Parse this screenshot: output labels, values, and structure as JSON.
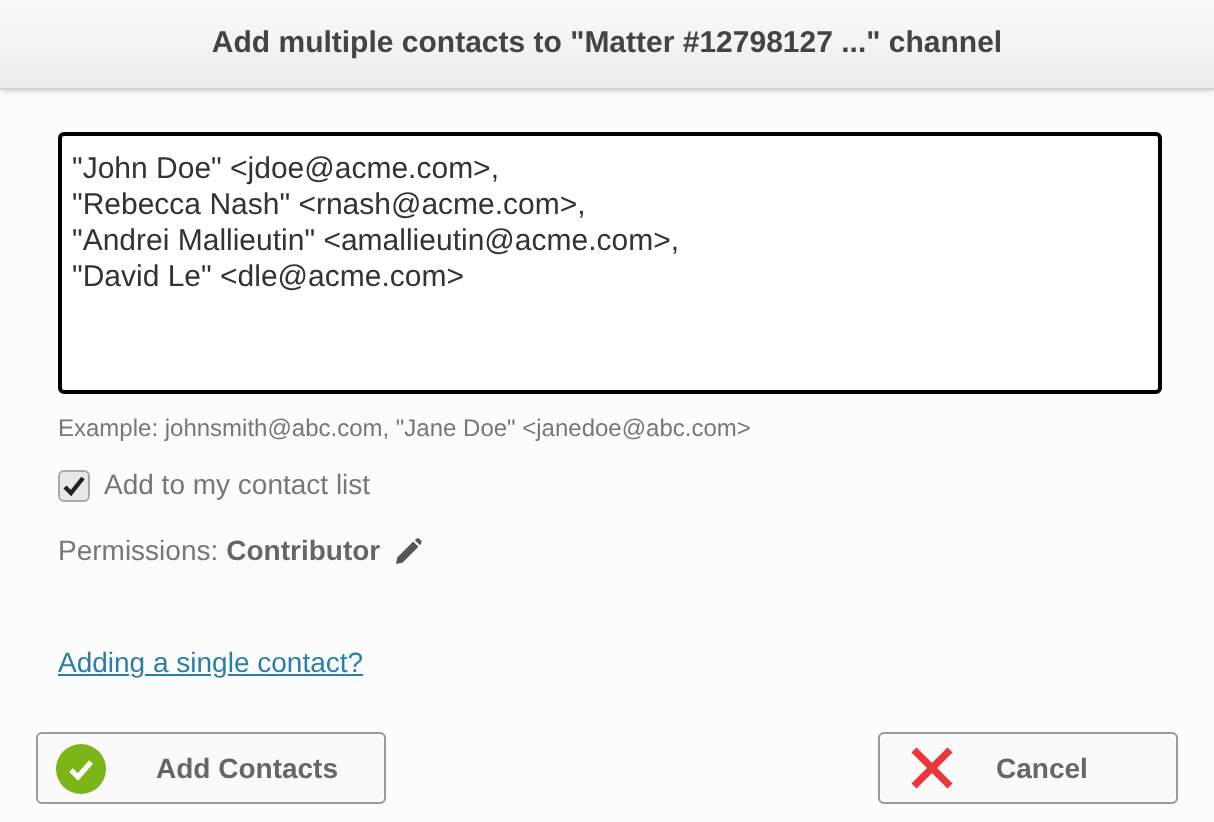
{
  "dialog": {
    "title": "Add multiple contacts to \"Matter #12798127 ...\" channel"
  },
  "contacts_field": {
    "lines": [
      "\"John Doe\" <jdoe@acme.com>,",
      "\"Rebecca Nash\" <rnash@acme.com>,",
      "\"Andrei Mallieutin\" <amallieutin@acme.com>,",
      "\"David Le\" <dle@acme.com>"
    ]
  },
  "example": "Example: johnsmith@abc.com, \"Jane Doe\" <janedoe@abc.com>",
  "add_to_contact_list": {
    "label": "Add to my contact list",
    "checked": true
  },
  "permissions": {
    "label": "Permissions:",
    "value": "Contributor"
  },
  "single_contact_link": "Adding a single contact?",
  "buttons": [
    {
      "kind": "confirm",
      "label": "Add Contacts"
    },
    {
      "kind": "cancel",
      "label": "Cancel"
    }
  ]
}
